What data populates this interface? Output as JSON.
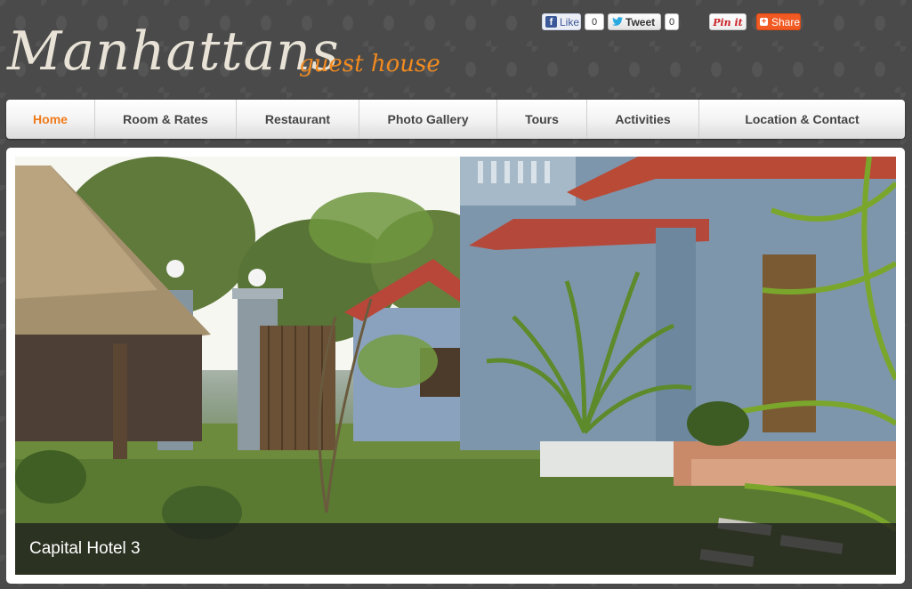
{
  "header": {
    "logo_main": "Manhattans",
    "logo_sub": "guest house"
  },
  "social": {
    "facebook": {
      "label": "Like",
      "count": "0"
    },
    "twitter": {
      "label": "Tweet",
      "count": "0"
    },
    "pinterest": {
      "label": "Pin it"
    },
    "share": {
      "label": "Share"
    }
  },
  "nav": {
    "items": [
      {
        "label": "Home",
        "active": true
      },
      {
        "label": "Room & Rates"
      },
      {
        "label": "Restaurant"
      },
      {
        "label": "Photo Gallery"
      },
      {
        "label": "Tours"
      },
      {
        "label": "Activities"
      },
      {
        "label": "Location & Contact"
      }
    ]
  },
  "slider": {
    "caption": "Capital Hotel 3"
  },
  "colors": {
    "accent": "#f18a1f",
    "nav_active": "#ef7a1a",
    "background": "#4a4a4a"
  }
}
